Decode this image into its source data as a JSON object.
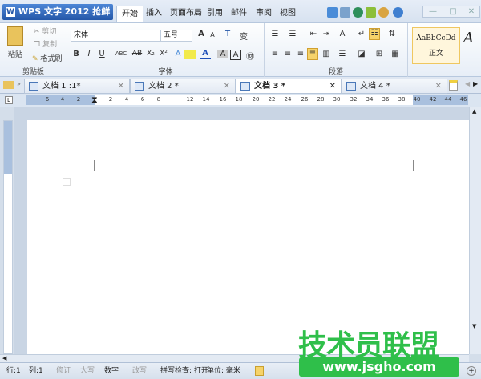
{
  "app": {
    "title": "WPS 文字 2012 抢鲜版",
    "logo": "W"
  },
  "menu_tabs": [
    "开始",
    "插入",
    "页面布局",
    "引用",
    "邮件",
    "审阅",
    "视图"
  ],
  "window": {
    "minimize": "—",
    "maximize": "□",
    "close": "✕"
  },
  "clipboard": {
    "paste": "粘贴",
    "cut": "剪切",
    "copy": "复制",
    "format_painter": "格式刷",
    "label": "剪贴板"
  },
  "font": {
    "name": "宋体",
    "size": "五号",
    "label": "字体",
    "bold": "B",
    "italic": "I",
    "underline": "U",
    "strike": "ABC",
    "double_strike": "AB",
    "subscript": "X₂",
    "superscript": "X²",
    "grow": "A",
    "shrink": "A"
  },
  "paragraph": {
    "label": "段落"
  },
  "styles": {
    "preview": "AaBbCcDd",
    "name": "正文"
  },
  "doc_tabs": [
    {
      "label": "文档 1 :1*"
    },
    {
      "label": "文档 2 *"
    },
    {
      "label": "文档 3 *",
      "active": true
    },
    {
      "label": "文档 4 *"
    }
  ],
  "ruler": {
    "ticks": [
      "6",
      "4",
      "2",
      "2",
      "4",
      "6",
      "8",
      "12",
      "14",
      "16",
      "18",
      "20",
      "22",
      "24",
      "26",
      "28",
      "30",
      "32",
      "34",
      "36",
      "38",
      "40",
      "42",
      "44",
      "46"
    ]
  },
  "status": {
    "row": "行:1",
    "col": "列:1",
    "revise": "修订",
    "caps": "大写",
    "num": "数字",
    "overwrite": "改写",
    "spell": "拼写检查: 打开",
    "unit": "单位: 毫米"
  },
  "watermark": {
    "text": "技术员联盟",
    "url": "www.jsgho.com"
  },
  "colors": {
    "accent": "#2457a8",
    "watermark": "#2fbf4a",
    "highlight": "#f6d36a"
  }
}
